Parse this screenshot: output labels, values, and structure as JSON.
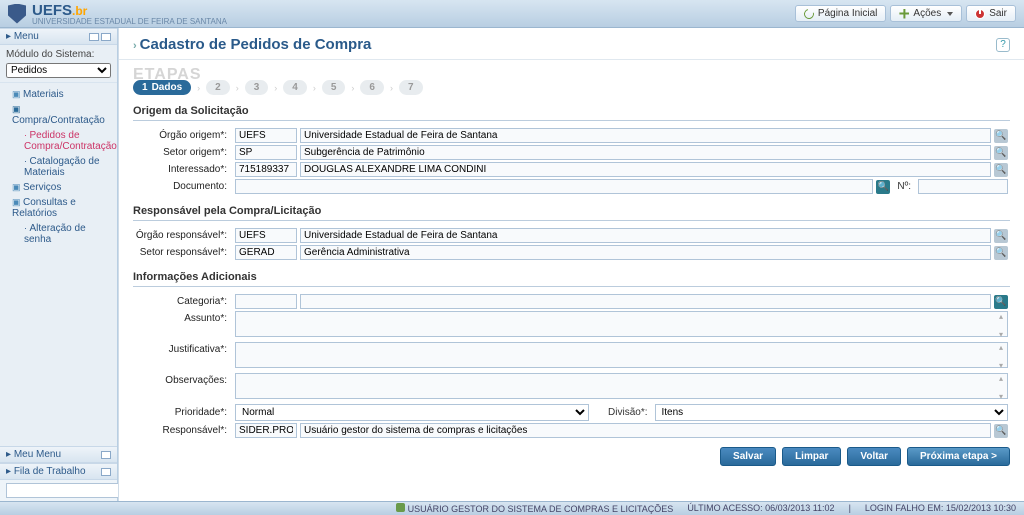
{
  "header": {
    "logo_main": "UEFS",
    "logo_suffix": ".br",
    "logo_sub": "UNIVERSIDADE ESTADUAL DE FEIRA DE SANTANA",
    "btn_home": "Página Inicial",
    "btn_actions": "Ações",
    "btn_exit": "Sair"
  },
  "sidebar": {
    "menu_title": "Menu",
    "module_label": "Módulo do Sistema:",
    "module_value": "Pedidos",
    "tree": {
      "materiais": "Materiais",
      "compra": "Compra/Contratação",
      "pedidos_link": "Pedidos de Compra/Contratação",
      "catalog_link": "Catalogação de Materiais",
      "servicos": "Serviços",
      "consultas": "Consultas e Relatórios",
      "alteracao": "Alteração de senha"
    },
    "meu_menu": "Meu Menu",
    "fila": "Fila de Trabalho"
  },
  "page": {
    "title": "Cadastro de Pedidos de Compra",
    "steps_label": "ETAPAS",
    "step_active": "Dados",
    "steps_rest": [
      "2",
      "3",
      "4",
      "5",
      "6",
      "7"
    ]
  },
  "sections": {
    "origem_title": "Origem da Solicitação",
    "responsavel_title": "Responsável pela Compra/Licitação",
    "info_title": "Informações Adicionais"
  },
  "form": {
    "orgao_origem_lbl": "Órgão origem*:",
    "orgao_origem_code": "UEFS",
    "orgao_origem_desc": "Universidade Estadual de Feira de Santana",
    "setor_origem_lbl": "Setor origem*:",
    "setor_origem_code": "SP",
    "setor_origem_desc": "Subgerência de Patrimônio",
    "interessado_lbl": "Interessado*:",
    "interessado_code": "715189337",
    "interessado_desc": "DOUGLAS ALEXANDRE LIMA CONDINI",
    "documento_lbl": "Documento:",
    "documento_val": "",
    "numero_lbl": "Nº:",
    "numero_val": "",
    "orgao_resp_lbl": "Órgão responsável*:",
    "orgao_resp_code": "UEFS",
    "orgao_resp_desc": "Universidade Estadual de Feira de Santana",
    "setor_resp_lbl": "Setor responsável*:",
    "setor_resp_code": "GERAD",
    "setor_resp_desc": "Gerência Administrativa",
    "categoria_lbl": "Categoria*:",
    "categoria_code": "",
    "categoria_desc": "",
    "assunto_lbl": "Assunto*:",
    "assunto_val": "",
    "justificativa_lbl": "Justificativa*:",
    "justificativa_val": "",
    "observacoes_lbl": "Observações:",
    "observacoes_val": "",
    "prioridade_lbl": "Prioridade*:",
    "prioridade_val": "Normal",
    "divisao_lbl": "Divisão*:",
    "divisao_val": "Itens",
    "responsavel_lbl": "Responsável*:",
    "responsavel_code": "SIDER.PRO",
    "responsavel_desc": "Usuário gestor do sistema de compras e licitações"
  },
  "buttons": {
    "salvar": "Salvar",
    "limpar": "Limpar",
    "voltar": "Voltar",
    "proxima": "Próxima etapa >"
  },
  "status": {
    "user": "USUÁRIO GESTOR DO SISTEMA DE COMPRAS E LICITAÇÕES",
    "last_access": "ÚLTIMO ACESSO: 06/03/2013 11:02",
    "login_fail": "LOGIN FALHO EM: 15/02/2013 10:30"
  }
}
